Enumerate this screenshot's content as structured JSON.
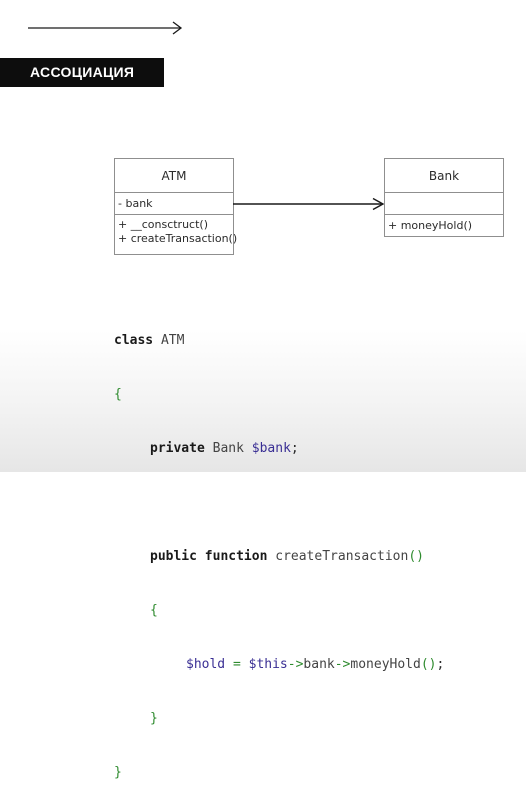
{
  "banner": {
    "title": "АССОЦИАЦИЯ"
  },
  "legend": {
    "icon": "association-arrow-icon"
  },
  "diagram": {
    "atm": {
      "name": "ATM",
      "attributes": [
        "- bank"
      ],
      "operations": [
        "+ __consctruct()",
        "+ createTransaction()"
      ]
    },
    "bank": {
      "name": "Bank",
      "attributes": [],
      "operations": [
        "+ moneyHold()"
      ]
    }
  },
  "code": {
    "class_kw": "class",
    "class_name": "ATM",
    "open_brace": "{",
    "private_kw": "private",
    "prop_type": "Bank",
    "prop_var": "$bank",
    "semicolon": ";",
    "public_kw": "public",
    "function_kw": "function",
    "method_name": "createTransaction",
    "parens": "()",
    "method_open": "{",
    "hold_var": "$hold",
    "assign": " = ",
    "this_var": "$this",
    "arrow1": "->",
    "bank_prop": "bank",
    "arrow2": "->",
    "money_call": "moneyHold",
    "call_parens": "()",
    "end_semicolon": ";",
    "method_close": "}",
    "close_brace": "}"
  },
  "colors": {
    "banner_bg": "#0d0d0d",
    "keyword": "#1a1a1a",
    "variable": "#3a2f94",
    "brace_green": "#2e8b2e"
  }
}
